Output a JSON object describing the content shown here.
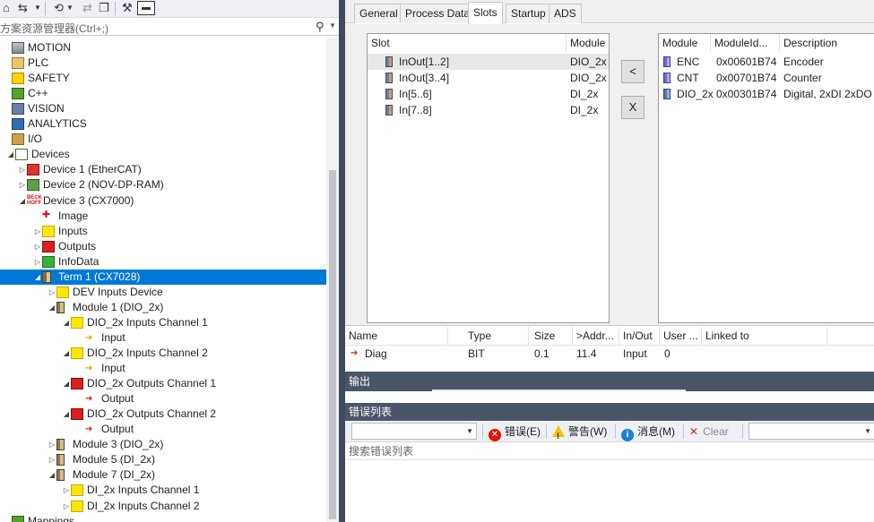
{
  "explorer": {
    "toolbar": {
      "icons": [
        "home-icon",
        "sync-icon",
        "history-icon",
        "properties-icon",
        "wrench-icon",
        "pin-icon"
      ]
    },
    "search_placeholder": "方案资源管理器(Ctrl+;)",
    "tree": [
      {
        "label": "MOTION",
        "icon": "motion-icon",
        "level": 0,
        "expander": ""
      },
      {
        "label": "PLC",
        "icon": "plc-icon",
        "level": 0,
        "expander": ""
      },
      {
        "label": "SAFETY",
        "icon": "safety-icon",
        "level": 0,
        "expander": ""
      },
      {
        "label": "C++",
        "icon": "cpp-icon",
        "level": 0,
        "expander": ""
      },
      {
        "label": "VISION",
        "icon": "vision-icon",
        "level": 0,
        "expander": ""
      },
      {
        "label": "ANALYTICS",
        "icon": "analytics-icon",
        "level": 0,
        "expander": ""
      },
      {
        "label": "I/O",
        "icon": "io-icon",
        "level": 0,
        "expander": ""
      },
      {
        "label": "Devices",
        "icon": "devices-icon",
        "level": 1,
        "expander": "expanded"
      },
      {
        "label": "Device 1 (EtherCAT)",
        "icon": "ethercat-icon",
        "level": 2,
        "expander": "collapsed"
      },
      {
        "label": "Device 2 (NOV-DP-RAM)",
        "icon": "nov-dp-ram-icon",
        "level": 2,
        "expander": "collapsed"
      },
      {
        "label": "Device 3 (CX7000)",
        "icon": "cx7000-icon",
        "level": 2,
        "expander": "expanded"
      },
      {
        "label": "Image",
        "icon": "image-icon",
        "level": 3,
        "expander": ""
      },
      {
        "label": "Inputs",
        "icon": "inputs-icon",
        "level": 3,
        "expander": "collapsed"
      },
      {
        "label": "Outputs",
        "icon": "outputs-icon",
        "level": 3,
        "expander": "collapsed"
      },
      {
        "label": "InfoData",
        "icon": "infodata-icon",
        "level": 3,
        "expander": "collapsed"
      },
      {
        "label": "Term 1 (CX7028)",
        "icon": "terminal-icon",
        "level": 3,
        "expander": "expanded",
        "selected": true
      },
      {
        "label": "DEV Inputs Device",
        "icon": "inputs-icon",
        "level": 4,
        "expander": "collapsed"
      },
      {
        "label": "Module 1 (DIO_2x)",
        "icon": "module-icon",
        "level": 4,
        "expander": "expanded"
      },
      {
        "label": "DIO_2x Inputs Channel 1",
        "icon": "inputs-icon",
        "level": 5,
        "expander": "expanded"
      },
      {
        "label": "Input",
        "icon": "input-var-icon",
        "level": 6,
        "expander": ""
      },
      {
        "label": "DIO_2x Inputs Channel 2",
        "icon": "inputs-icon",
        "level": 5,
        "expander": "expanded"
      },
      {
        "label": "Input",
        "icon": "input-var-icon",
        "level": 6,
        "expander": ""
      },
      {
        "label": "DIO_2x Outputs Channel 1",
        "icon": "outputs-icon",
        "level": 5,
        "expander": "expanded"
      },
      {
        "label": "Output",
        "icon": "output-var-icon",
        "level": 6,
        "expander": ""
      },
      {
        "label": "DIO_2x Outputs Channel 2",
        "icon": "outputs-icon",
        "level": 5,
        "expander": "expanded"
      },
      {
        "label": "Output",
        "icon": "output-var-icon",
        "level": 6,
        "expander": ""
      },
      {
        "label": "Module 3 (DIO_2x)",
        "icon": "module-icon",
        "level": 4,
        "expander": "collapsed"
      },
      {
        "label": "Module 5 (DI_2x)",
        "icon": "module-icon",
        "level": 4,
        "expander": "collapsed"
      },
      {
        "label": "Module 7 (DI_2x)",
        "icon": "module-icon",
        "level": 4,
        "expander": "expanded"
      },
      {
        "label": "DI_2x Inputs Channel 1",
        "icon": "inputs-icon",
        "level": 5,
        "expander": "collapsed"
      },
      {
        "label": "DI_2x Inputs Channel 2",
        "icon": "inputs-icon",
        "level": 5,
        "expander": "collapsed"
      },
      {
        "label": "Mappings",
        "icon": "mappings-icon",
        "level": 0,
        "expander": ""
      }
    ]
  },
  "tabs": [
    {
      "label": "General",
      "active": false
    },
    {
      "label": "Process Data",
      "active": false
    },
    {
      "label": "Slots",
      "active": true
    },
    {
      "label": "Startup",
      "active": false
    },
    {
      "label": "ADS",
      "active": false
    }
  ],
  "slots": {
    "slot_table": {
      "headers": [
        "Slot",
        "Module"
      ],
      "rows": [
        {
          "slot": "InOut[1..2]",
          "module": "DIO_2x",
          "highlighted": true
        },
        {
          "slot": "InOut[3..4]",
          "module": "DIO_2x",
          "highlighted": false
        },
        {
          "slot": "In[5..6]",
          "module": "DI_2x",
          "highlighted": false
        },
        {
          "slot": "In[7..8]",
          "module": "DI_2x",
          "highlighted": false
        }
      ]
    },
    "buttons": {
      "insert": "<",
      "remove": "X"
    },
    "module_table": {
      "headers": [
        "Module",
        "ModuleId...",
        "Description"
      ],
      "rows": [
        {
          "module": "ENC",
          "id": "0x00601B74",
          "description": "Encoder"
        },
        {
          "module": "CNT",
          "id": "0x00701B74",
          "description": "Counter"
        },
        {
          "module": "DIO_2x",
          "id": "0x00301B74",
          "description": "Digital, 2xDI 2xDO"
        }
      ]
    }
  },
  "variables": {
    "headers": [
      "Name",
      "Type",
      "Size",
      ">Addr...",
      "In/Out",
      "User ...",
      "Linked to"
    ],
    "rows": [
      {
        "name": "Diag",
        "type": "BIT",
        "size": "0.1",
        "addr": "11.4",
        "inout": "Input",
        "user": "0",
        "linked": ""
      }
    ]
  },
  "output_panel": {
    "title": "输出"
  },
  "error_list": {
    "title": "错误列表",
    "errors_label": "错误(E)",
    "warnings_label": "警告(W)",
    "messages_label": "消息(M)",
    "clear_label": "Clear",
    "search_placeholder": "搜索错误列表"
  },
  "colors": {
    "selection": "#0078d7",
    "panel_title": "#4a5568",
    "splitter": "#3f4a60"
  }
}
